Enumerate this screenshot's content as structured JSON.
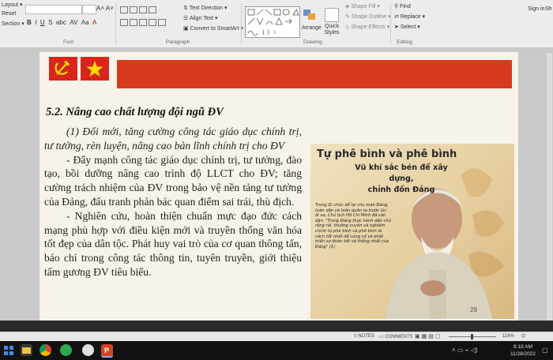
{
  "ribbon": {
    "left_items": [
      "Layout",
      "Reset",
      "Section"
    ],
    "paragraph": {
      "text_direction": "Text Direction",
      "align_text": "Align Text",
      "convert_smartart": "Convert to SmartArt",
      "group_label": "Paragraph"
    },
    "font_group_label": "Font",
    "drawing": {
      "arrange": "Arrange",
      "quick_styles": "Quick Styles",
      "shape_fill": "Shape Fill",
      "shape_outline": "Shape Outline",
      "shape_effects": "Shape Effects",
      "group_label": "Drawing"
    },
    "editing": {
      "find": "Find",
      "replace": "Replace",
      "select": "Select",
      "group_label": "Editing"
    },
    "sign_in": "Sign in",
    "share": "Sh"
  },
  "slide": {
    "heading": "5.2. Nâng cao chất lượng đội ngũ ĐV",
    "paragraphs": [
      "(1) Đổi mới, tăng cường công tác giáo dục chính trị, tư tưởng, rèn luyện, nâng cao bản lĩnh chính trị cho ĐV",
      "- Đẩy mạnh công tác giáo dục chính trị, tư tưởng, đào tạo, bồi dưỡng nâng cao trình độ LLCT cho ĐV; tăng cường trách nhiệm của ĐV trong bảo vệ nền tảng tư tưởng của Đảng, đấu tranh phản bác quan điểm sai trái, thù địch.",
      "- Nghiên cứu, hoàn thiện chuẩn mực đạo đức cách mạng phù hợp với điều kiện mới và truyền thống văn hóa tốt đẹp của dân tộc. Phát huy vai trò của cơ quan thông tấn, báo chí trong công tác thông tin, tuyên truyền, giới thiệu tấm gương ĐV tiêu biểu."
    ],
    "image": {
      "title": "Tự phê bình và phê bình",
      "subtitle_1": "Vũ khí sắc bén để xây dựng,",
      "subtitle_2": "chỉnh đốn Đảng",
      "quote": "Trong Di chúc để lại cho toàn Đảng, toàn dân và toàn quân ta trước lúc đi xa, Chủ tịch Hồ Chí Minh đã căn dặn: \"Trong Đảng thực hành dân chủ rộng rãi, thường xuyên và nghiêm chỉnh tự phê bình và phê bình là cách tốt nhất để củng cố và phát triển sự đoàn kết và thống nhất của Đảng\" (1)",
      "page_number": "29"
    }
  },
  "statusbar": {
    "notes": "NOTES",
    "comments": "COMMENTS",
    "zoom": "116%"
  },
  "taskbar": {
    "time": "8:18 AM",
    "date": "11/28/2022"
  },
  "colors": {
    "banner": "#d63a1c",
    "flag_red": "#da251d",
    "star": "#ffde00"
  }
}
